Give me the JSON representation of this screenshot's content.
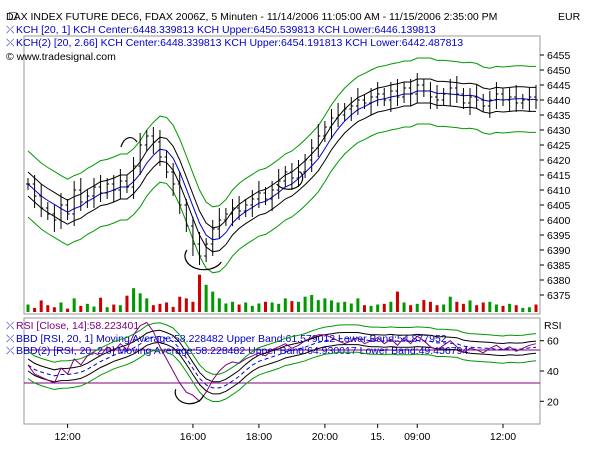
{
  "header": {
    "title": "DAX INDEX FUTURE DEC6, FDAX 2006Z, 5 Minuten - 11/14/2006 11:05:00 AM - 11/15/2006 2:35:00 PM",
    "currency": "EUR",
    "kch1_label": "KCH [20, 1] KCH Center:6448.339813 KCH Upper:6450.539813 KCH Lower:6446.139813",
    "kch2_label": "KCH(2) [20, 2.66] KCH Center:6448.339813 KCH Upper:6454.191813 KCH Lower:6442.487813",
    "source": "© www.tradesignal.com"
  },
  "lower_panel": {
    "rsi_label": "RSI [Close, 14]:58.223401",
    "bbd1_label": "BBD [RSI, 20, 1] Moving Average:58.228482 Upper Band:61.579012 Lower Band:54.877952",
    "bbd2_label": "BBD(2) [RSI, 20, 2.0] Moving Average:58.228482 Upper Band:64.930017 Lower Band:49.456794",
    "axis_title": "RSI"
  },
  "colors": {
    "kch_inner": "#0000cc",
    "kch_inner_bands": "#000000",
    "kch_outer_bands": "#009900",
    "rsi": "#800080",
    "bbd_ma": "#0000cc",
    "bbd1_bands": "#000000",
    "bbd2_bands": "#009900",
    "volume_up": "#009900",
    "volume_down": "#cc0000",
    "annotation": "#000000"
  },
  "chart_data": {
    "type": "ohlc",
    "x_ticks": [
      "12:00",
      "16:00",
      "18:00",
      "20:00",
      "15.",
      "09:00",
      "12:00"
    ],
    "price_axis": {
      "ticks": [
        6375,
        6380,
        6385,
        6390,
        6395,
        6400,
        6405,
        6410,
        6415,
        6420,
        6425,
        6430,
        6435,
        6440,
        6445,
        6450,
        6455
      ],
      "ylim": [
        6370,
        6460
      ]
    },
    "rsi_axis": {
      "ticks": [
        20,
        40,
        60
      ],
      "ylim": [
        5,
        75
      ],
      "reference_lines": [
        30,
        70
      ]
    },
    "bar_count": 78,
    "close": [
      6412,
      6408,
      6404,
      6402,
      6400,
      6405,
      6402,
      6410,
      6406,
      6408,
      6411,
      6409,
      6412,
      6410,
      6413,
      6411,
      6418,
      6425,
      6428,
      6426,
      6421,
      6416,
      6412,
      6405,
      6398,
      6392,
      6388,
      6392,
      6397,
      6400,
      6402,
      6404,
      6403,
      6405,
      6407,
      6409,
      6407,
      6410,
      6413,
      6416,
      6414,
      6416,
      6420,
      6424,
      6428,
      6431,
      6434,
      6435,
      6437,
      6438,
      6440,
      6439,
      6441,
      6442,
      6440,
      6443,
      6441,
      6444,
      6442,
      6445,
      6443,
      6441,
      6440,
      6442,
      6444,
      6442,
      6439,
      6441,
      6440,
      6438,
      6440,
      6442,
      6440,
      6441,
      6439,
      6440,
      6441,
      6440
    ],
    "volume": [
      22,
      12,
      34,
      20,
      14,
      28,
      10,
      40,
      18,
      24,
      16,
      42,
      14,
      22,
      20,
      48,
      70,
      55,
      40,
      20,
      24,
      28,
      15,
      45,
      40,
      30,
      110,
      80,
      60,
      40,
      25,
      30,
      22,
      28,
      18,
      25,
      30,
      28,
      24,
      40,
      32,
      30,
      45,
      50,
      35,
      40,
      34,
      28,
      30,
      25,
      40,
      20,
      18,
      22,
      24,
      30,
      60,
      28,
      20,
      24,
      35,
      30,
      20,
      22,
      45,
      30,
      24,
      34,
      20,
      28,
      30,
      22,
      18,
      24,
      20,
      12,
      14,
      22
    ],
    "rsi_values": [
      44,
      38,
      36,
      34,
      32,
      42,
      38,
      48,
      44,
      50,
      52,
      50,
      56,
      53,
      58,
      54,
      64,
      70,
      72,
      66,
      56,
      48,
      40,
      32,
      26,
      24,
      20,
      26,
      34,
      40,
      44,
      46,
      45,
      48,
      50,
      52,
      50,
      54,
      56,
      58,
      55,
      57,
      60,
      62,
      64,
      64,
      62,
      60,
      58,
      60,
      62,
      58,
      60,
      62,
      58,
      61,
      57,
      62,
      58,
      63,
      60,
      56,
      54,
      57,
      60,
      56,
      52,
      55,
      54,
      52,
      55,
      57,
      54,
      56,
      53,
      55,
      57,
      58
    ]
  }
}
